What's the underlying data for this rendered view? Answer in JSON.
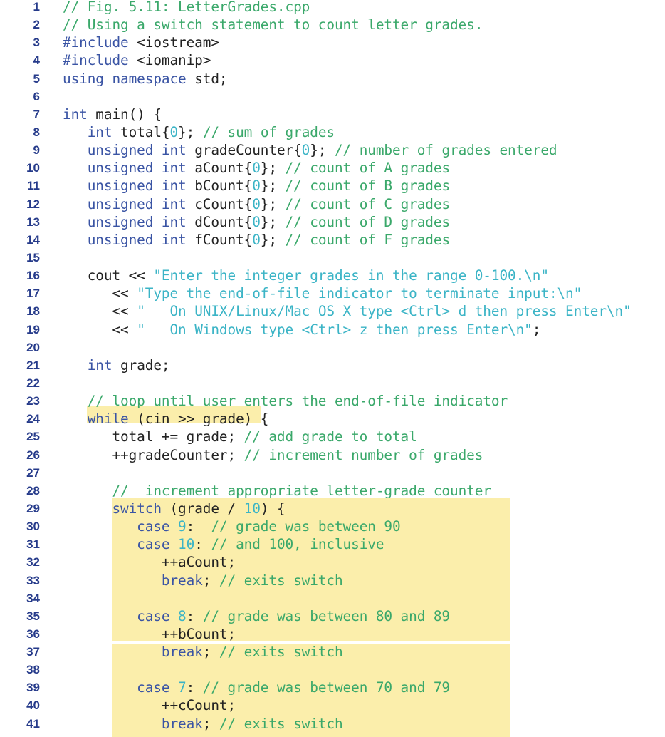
{
  "document": {
    "title": "Fig. 5.11: LetterGrades.cpp",
    "language": "C++",
    "colors": {
      "line_number": "#253a8a",
      "keyword": "#3a54a4",
      "comment": "#3aa86a",
      "string_literal": "#3bb4c6",
      "number_literal": "#3bb4c6",
      "plain": "#222222",
      "highlight": "#fbeeab"
    },
    "highlights": [
      {
        "lines": "24",
        "text": "while (cin >> grade)"
      },
      {
        "lines": "29-36"
      },
      {
        "lines": "37-41"
      }
    ],
    "lines": [
      {
        "n": "1",
        "indent": 0,
        "tokens": [
          {
            "t": "cm",
            "v": "// Fig. 5.11: LetterGrades.cpp"
          }
        ]
      },
      {
        "n": "2",
        "indent": 0,
        "tokens": [
          {
            "t": "cm",
            "v": "// Using a switch statement to count letter grades."
          }
        ]
      },
      {
        "n": "3",
        "indent": 0,
        "tokens": [
          {
            "t": "kw",
            "v": "#include"
          },
          {
            "t": "pl",
            "v": " <iostream>"
          }
        ]
      },
      {
        "n": "4",
        "indent": 0,
        "tokens": [
          {
            "t": "kw",
            "v": "#include"
          },
          {
            "t": "pl",
            "v": " <iomanip>"
          }
        ]
      },
      {
        "n": "5",
        "indent": 0,
        "tokens": [
          {
            "t": "kw",
            "v": "using namespace"
          },
          {
            "t": "pl",
            "v": " std;"
          }
        ]
      },
      {
        "n": "6",
        "indent": 0,
        "tokens": []
      },
      {
        "n": "7",
        "indent": 0,
        "tokens": [
          {
            "t": "kw",
            "v": "int"
          },
          {
            "t": "pl",
            "v": " main() {"
          }
        ]
      },
      {
        "n": "8",
        "indent": 3,
        "tokens": [
          {
            "t": "kw",
            "v": "int"
          },
          {
            "t": "pl",
            "v": " total{"
          },
          {
            "t": "nm",
            "v": "0"
          },
          {
            "t": "pl",
            "v": "}; "
          },
          {
            "t": "cm",
            "v": "// sum of grades"
          }
        ]
      },
      {
        "n": "9",
        "indent": 3,
        "tokens": [
          {
            "t": "kw",
            "v": "unsigned int"
          },
          {
            "t": "pl",
            "v": " gradeCounter{"
          },
          {
            "t": "nm",
            "v": "0"
          },
          {
            "t": "pl",
            "v": "}; "
          },
          {
            "t": "cm",
            "v": "// number of grades entered"
          }
        ]
      },
      {
        "n": "10",
        "indent": 3,
        "tokens": [
          {
            "t": "kw",
            "v": "unsigned int"
          },
          {
            "t": "pl",
            "v": " aCount{"
          },
          {
            "t": "nm",
            "v": "0"
          },
          {
            "t": "pl",
            "v": "}; "
          },
          {
            "t": "cm",
            "v": "// count of A grades"
          }
        ]
      },
      {
        "n": "11",
        "indent": 3,
        "tokens": [
          {
            "t": "kw",
            "v": "unsigned int"
          },
          {
            "t": "pl",
            "v": " bCount{"
          },
          {
            "t": "nm",
            "v": "0"
          },
          {
            "t": "pl",
            "v": "}; "
          },
          {
            "t": "cm",
            "v": "// count of B grades"
          }
        ]
      },
      {
        "n": "12",
        "indent": 3,
        "tokens": [
          {
            "t": "kw",
            "v": "unsigned int"
          },
          {
            "t": "pl",
            "v": " cCount{"
          },
          {
            "t": "nm",
            "v": "0"
          },
          {
            "t": "pl",
            "v": "}; "
          },
          {
            "t": "cm",
            "v": "// count of C grades"
          }
        ]
      },
      {
        "n": "13",
        "indent": 3,
        "tokens": [
          {
            "t": "kw",
            "v": "unsigned int"
          },
          {
            "t": "pl",
            "v": " dCount{"
          },
          {
            "t": "nm",
            "v": "0"
          },
          {
            "t": "pl",
            "v": "}; "
          },
          {
            "t": "cm",
            "v": "// count of D grades"
          }
        ]
      },
      {
        "n": "14",
        "indent": 3,
        "tokens": [
          {
            "t": "kw",
            "v": "unsigned int"
          },
          {
            "t": "pl",
            "v": " fCount{"
          },
          {
            "t": "nm",
            "v": "0"
          },
          {
            "t": "pl",
            "v": "}; "
          },
          {
            "t": "cm",
            "v": "// count of F grades"
          }
        ]
      },
      {
        "n": "15",
        "indent": 0,
        "tokens": []
      },
      {
        "n": "16",
        "indent": 3,
        "tokens": [
          {
            "t": "pl",
            "v": "cout << "
          },
          {
            "t": "st",
            "v": "\"Enter the integer grades in the range 0-100.\\n\""
          }
        ]
      },
      {
        "n": "17",
        "indent": 6,
        "tokens": [
          {
            "t": "pl",
            "v": "<< "
          },
          {
            "t": "st",
            "v": "\"Type the end-of-file indicator to terminate input:\\n\""
          }
        ]
      },
      {
        "n": "18",
        "indent": 6,
        "tokens": [
          {
            "t": "pl",
            "v": "<< "
          },
          {
            "t": "st",
            "v": "\"   On UNIX/Linux/Mac OS X type <Ctrl> d then press Enter\\n\""
          }
        ]
      },
      {
        "n": "19",
        "indent": 6,
        "tokens": [
          {
            "t": "pl",
            "v": "<< "
          },
          {
            "t": "st",
            "v": "\"   On Windows type <Ctrl> z then press Enter\\n\""
          },
          {
            "t": "pl",
            "v": ";"
          }
        ]
      },
      {
        "n": "20",
        "indent": 0,
        "tokens": []
      },
      {
        "n": "21",
        "indent": 3,
        "tokens": [
          {
            "t": "kw",
            "v": "int"
          },
          {
            "t": "pl",
            "v": " grade;"
          }
        ]
      },
      {
        "n": "22",
        "indent": 0,
        "tokens": []
      },
      {
        "n": "23",
        "indent": 3,
        "tokens": [
          {
            "t": "cm",
            "v": "// loop until user enters the end-of-file indicator"
          }
        ]
      },
      {
        "n": "24",
        "indent": 3,
        "tokens": [
          {
            "t": "kw",
            "v": "while"
          },
          {
            "t": "pl",
            "v": " (cin >> grade) {"
          }
        ]
      },
      {
        "n": "25",
        "indent": 6,
        "tokens": [
          {
            "t": "pl",
            "v": "total += grade; "
          },
          {
            "t": "cm",
            "v": "// add grade to total"
          }
        ]
      },
      {
        "n": "26",
        "indent": 6,
        "tokens": [
          {
            "t": "pl",
            "v": "++gradeCounter; "
          },
          {
            "t": "cm",
            "v": "// increment number of grades"
          }
        ]
      },
      {
        "n": "27",
        "indent": 0,
        "tokens": []
      },
      {
        "n": "28",
        "indent": 6,
        "tokens": [
          {
            "t": "cm",
            "v": "//  increment appropriate letter-grade counter"
          }
        ]
      },
      {
        "n": "29",
        "indent": 6,
        "tokens": [
          {
            "t": "kw",
            "v": "switch"
          },
          {
            "t": "pl",
            "v": " (grade / "
          },
          {
            "t": "nm",
            "v": "10"
          },
          {
            "t": "pl",
            "v": ") {"
          }
        ]
      },
      {
        "n": "30",
        "indent": 9,
        "tokens": [
          {
            "t": "kw",
            "v": "case"
          },
          {
            "t": "pl",
            "v": " "
          },
          {
            "t": "nm",
            "v": "9"
          },
          {
            "t": "pl",
            "v": ":  "
          },
          {
            "t": "cm",
            "v": "// grade was between 90"
          }
        ]
      },
      {
        "n": "31",
        "indent": 9,
        "tokens": [
          {
            "t": "kw",
            "v": "case"
          },
          {
            "t": "pl",
            "v": " "
          },
          {
            "t": "nm",
            "v": "10"
          },
          {
            "t": "pl",
            "v": ": "
          },
          {
            "t": "cm",
            "v": "// and 100, inclusive"
          }
        ]
      },
      {
        "n": "32",
        "indent": 12,
        "tokens": [
          {
            "t": "pl",
            "v": "++aCount;"
          }
        ]
      },
      {
        "n": "33",
        "indent": 12,
        "tokens": [
          {
            "t": "kw",
            "v": "break"
          },
          {
            "t": "pl",
            "v": "; "
          },
          {
            "t": "cm",
            "v": "// exits switch"
          }
        ]
      },
      {
        "n": "34",
        "indent": 0,
        "tokens": []
      },
      {
        "n": "35",
        "indent": 9,
        "tokens": [
          {
            "t": "kw",
            "v": "case"
          },
          {
            "t": "pl",
            "v": " "
          },
          {
            "t": "nm",
            "v": "8"
          },
          {
            "t": "pl",
            "v": ": "
          },
          {
            "t": "cm",
            "v": "// grade was between 80 and 89"
          }
        ]
      },
      {
        "n": "36",
        "indent": 12,
        "tokens": [
          {
            "t": "pl",
            "v": "++bCount;"
          }
        ]
      },
      {
        "n": "37",
        "indent": 12,
        "tokens": [
          {
            "t": "kw",
            "v": "break"
          },
          {
            "t": "pl",
            "v": "; "
          },
          {
            "t": "cm",
            "v": "// exits switch"
          }
        ]
      },
      {
        "n": "38",
        "indent": 0,
        "tokens": []
      },
      {
        "n": "39",
        "indent": 9,
        "tokens": [
          {
            "t": "kw",
            "v": "case"
          },
          {
            "t": "pl",
            "v": " "
          },
          {
            "t": "nm",
            "v": "7"
          },
          {
            "t": "pl",
            "v": ": "
          },
          {
            "t": "cm",
            "v": "// grade was between 70 and 79"
          }
        ]
      },
      {
        "n": "40",
        "indent": 12,
        "tokens": [
          {
            "t": "pl",
            "v": "++cCount;"
          }
        ]
      },
      {
        "n": "41",
        "indent": 12,
        "tokens": [
          {
            "t": "kw",
            "v": "break"
          },
          {
            "t": "pl",
            "v": "; "
          },
          {
            "t": "cm",
            "v": "// exits switch"
          }
        ]
      }
    ]
  }
}
